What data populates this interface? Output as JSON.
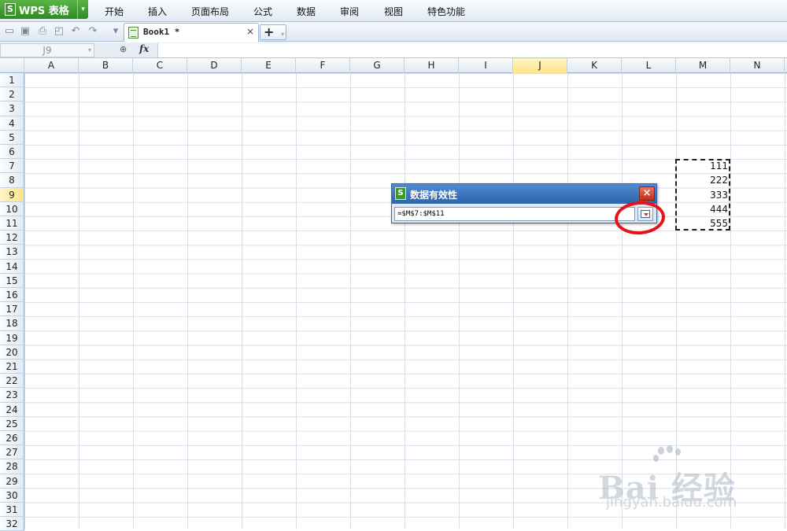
{
  "app": {
    "name": "WPS 表格",
    "logo_letter": "S",
    "dropdown_icon": "chevron-down-icon"
  },
  "menu": [
    "开始",
    "插入",
    "页面布局",
    "公式",
    "数据",
    "审阅",
    "视图",
    "特色功能"
  ],
  "toolbar": {
    "icons": [
      "open-icon",
      "save-icon",
      "print-icon",
      "print-preview-icon",
      "undo-icon",
      "redo-icon",
      "customize-icon"
    ],
    "doc_tab": {
      "name": "Book1 *",
      "close": "×"
    },
    "new_tab": "+"
  },
  "formula_bar": {
    "name_box": "J9",
    "zoom_symbol": "⊕",
    "fx_label": "fx",
    "value": ""
  },
  "grid": {
    "columns": [
      "A",
      "B",
      "C",
      "D",
      "E",
      "F",
      "G",
      "H",
      "I",
      "J",
      "K",
      "L",
      "M",
      "N"
    ],
    "rows": [
      "1",
      "2",
      "3",
      "4",
      "5",
      "6",
      "7",
      "8",
      "9",
      "10",
      "11",
      "12",
      "13",
      "14",
      "15",
      "16",
      "17",
      "18",
      "19",
      "20",
      "21",
      "22",
      "23",
      "24",
      "25",
      "26",
      "27",
      "28",
      "29",
      "30",
      "31",
      "32"
    ],
    "active_column": "J",
    "active_row": "9",
    "cells": [
      {
        "ref": "M7",
        "value": "111"
      },
      {
        "ref": "M8",
        "value": "222"
      },
      {
        "ref": "M9",
        "value": "333"
      },
      {
        "ref": "M10",
        "value": "444"
      },
      {
        "ref": "M11",
        "value": "555"
      }
    ]
  },
  "dialog": {
    "title": "数据有效性",
    "logo_letter": "S",
    "close": "×",
    "range_value": "=$M$7:$M$11"
  },
  "annotation": {
    "color": "#e8131a"
  },
  "watermark": {
    "brand": "Bai 经验",
    "url": "jingyan.baidu.com"
  },
  "colors": {
    "app_green": "#3c9a2c",
    "title_blue": "#2d64ab",
    "active_header": "#ffe38a"
  }
}
